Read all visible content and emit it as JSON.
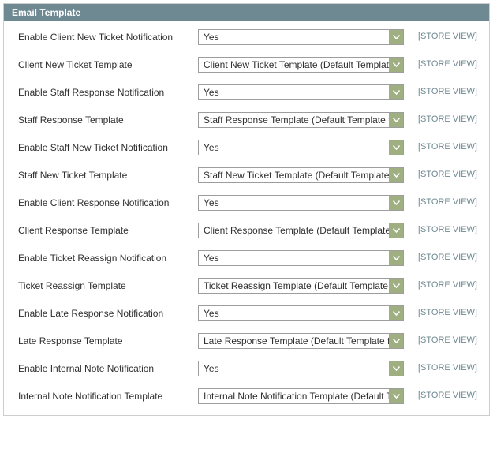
{
  "panel": {
    "title": "Email Template"
  },
  "scope_label": "[STORE VIEW]",
  "rows": [
    {
      "label": "Enable Client New Ticket Notification",
      "value": "Yes"
    },
    {
      "label": "Client New Ticket Template",
      "value": "Client New Ticket Template (Default Template from Locale)"
    },
    {
      "label": "Enable Staff Response Notification",
      "value": "Yes"
    },
    {
      "label": "Staff Response Template",
      "value": "Staff Response Template (Default Template from Locale)"
    },
    {
      "label": "Enable Staff New Ticket Notification",
      "value": "Yes"
    },
    {
      "label": "Staff New Ticket Template",
      "value": "Staff New Ticket Template (Default Template from Locale)"
    },
    {
      "label": "Enable Client Response Notification",
      "value": "Yes"
    },
    {
      "label": "Client Response Template",
      "value": "Client Response Template (Default Template from Locale)"
    },
    {
      "label": "Enable Ticket Reassign Notification",
      "value": "Yes"
    },
    {
      "label": "Ticket Reassign Template",
      "value": "Ticket Reassign Template (Default Template from Locale)"
    },
    {
      "label": "Enable Late Response Notification",
      "value": "Yes"
    },
    {
      "label": "Late Response Template",
      "value": "Late Response Template (Default Template from Locale)"
    },
    {
      "label": "Enable Internal Note Notification",
      "value": "Yes"
    },
    {
      "label": "Internal Note Notification Template",
      "value": "Internal Note Notification Template (Default Template from Locale)"
    }
  ]
}
